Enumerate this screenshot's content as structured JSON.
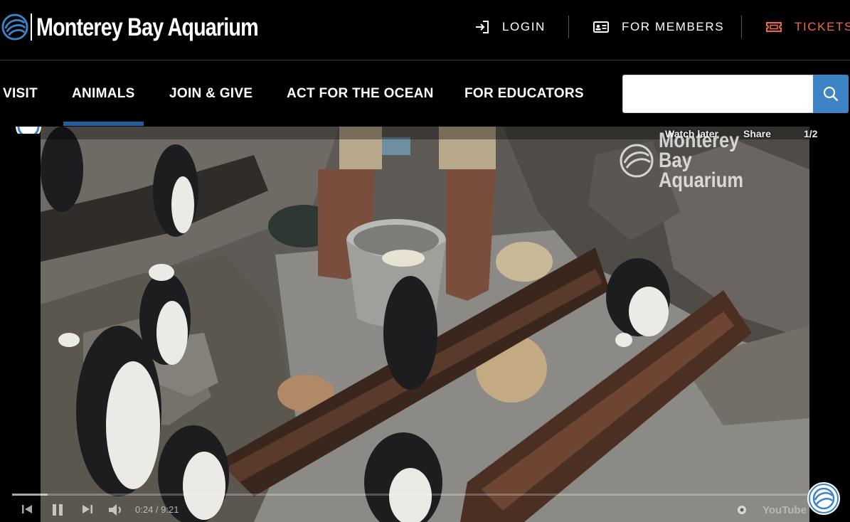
{
  "brand": {
    "name": "Monterey Bay Aquarium"
  },
  "utility_nav": {
    "login": "LOGIN",
    "members": "FOR MEMBERS",
    "tickets": "TICKETS"
  },
  "main_nav": {
    "items": [
      {
        "label": "VISIT",
        "active": false
      },
      {
        "label": "ANIMALS",
        "active": true
      },
      {
        "label": "JOIN & GIVE",
        "active": false
      },
      {
        "label": "ACT FOR THE OCEAN",
        "active": false
      },
      {
        "label": "FOR EDUCATORS",
        "active": false
      }
    ],
    "search_value": ""
  },
  "video": {
    "watch_later": "Watch later",
    "share": "Share",
    "playlist_position": "1/2",
    "watermark": "Monterey Bay Aquarium",
    "time": "0:24 / 9:21",
    "youtube": "YouTube",
    "progress": 0.043
  },
  "colors": {
    "accent_orange": "#ef6a3f",
    "active_underline": "#1f5fa0",
    "search_button": "#3d84c6"
  }
}
